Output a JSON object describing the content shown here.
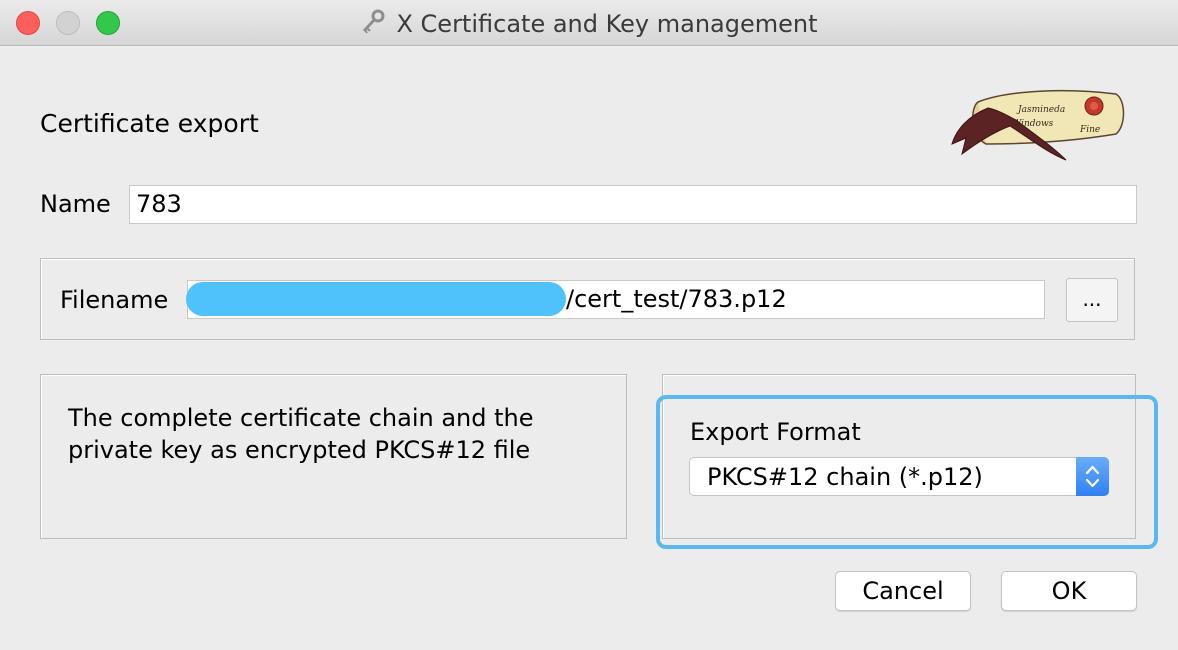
{
  "window": {
    "title": "X Certificate and Key management",
    "title_icon": "key-icon"
  },
  "dialog": {
    "heading": "Certificate export",
    "logo": "scroll-logo-icon",
    "name": {
      "label": "Name",
      "value": "783"
    },
    "filename": {
      "label": "Filename",
      "value_visible": "/cert_test/783.p12",
      "browse_label": "..."
    },
    "description": "The complete certificate chain and the private key as encrypted PKCS#12 file",
    "export_format": {
      "label": "Export Format",
      "selected": "PKCS#12 chain (*.p12)"
    },
    "buttons": {
      "cancel": "Cancel",
      "ok": "OK"
    }
  },
  "colors": {
    "window_bg": "#ececec",
    "focus_ring": "#5ab8ef",
    "redaction": "#4fc1fb",
    "close": "#fc605c",
    "zoom": "#34c84a",
    "stepper": "#2f7ff0"
  }
}
